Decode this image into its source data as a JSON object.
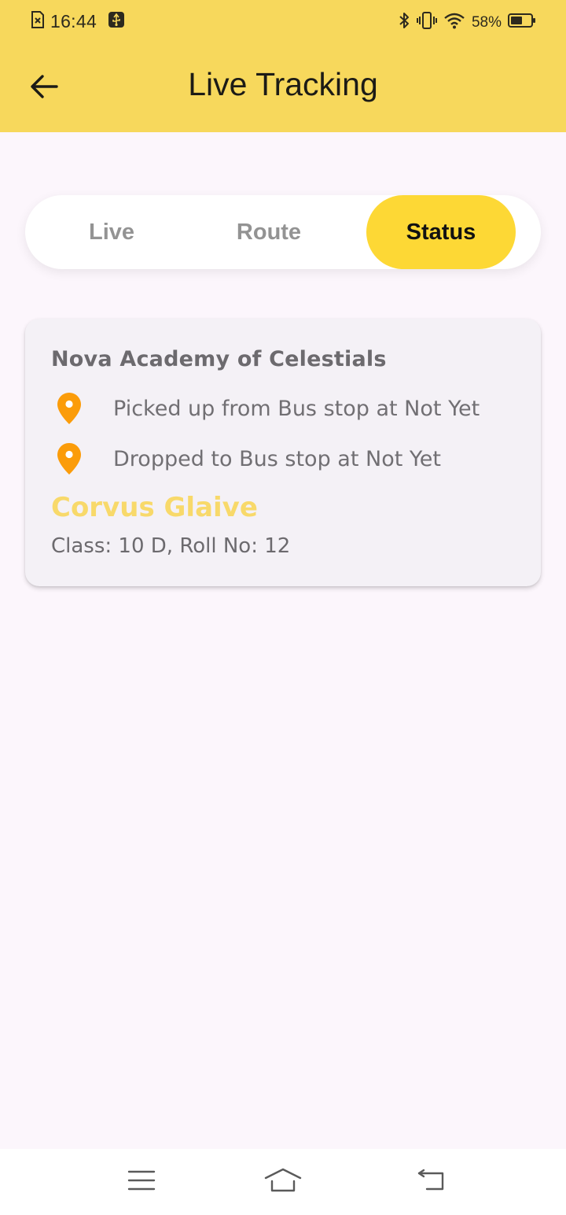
{
  "status_bar": {
    "time": "16:44",
    "battery_percent": "58%",
    "battery_level": 0.58,
    "icons": [
      "sim-error-icon",
      "usb-debug-icon",
      "bluetooth-icon",
      "vibrate-icon",
      "wifi-icon",
      "battery-icon"
    ]
  },
  "header": {
    "title": "Live Tracking",
    "back_icon": "arrow-left-icon"
  },
  "tabs": [
    {
      "label": "Live",
      "active": false
    },
    {
      "label": "Route",
      "active": false
    },
    {
      "label": "Status",
      "active": true
    }
  ],
  "status_card": {
    "school": "Nova Academy of Celestials",
    "pickup_text": "Picked up from Bus stop at Not Yet",
    "drop_text": "Dropped to Bus stop at Not Yet",
    "student_name": "Corvus Glaive",
    "student_meta": "Class: 10 D, Roll No: 12"
  },
  "nav_bar": {
    "icons": [
      "menu-icon",
      "home-icon",
      "back-icon"
    ]
  },
  "colors": {
    "header_bg": "#f7d85c",
    "active_tab": "#fdd835",
    "pin": "#fb9c0a",
    "student_name": "#f8d96a",
    "page_bg": "#fcf6fc"
  }
}
